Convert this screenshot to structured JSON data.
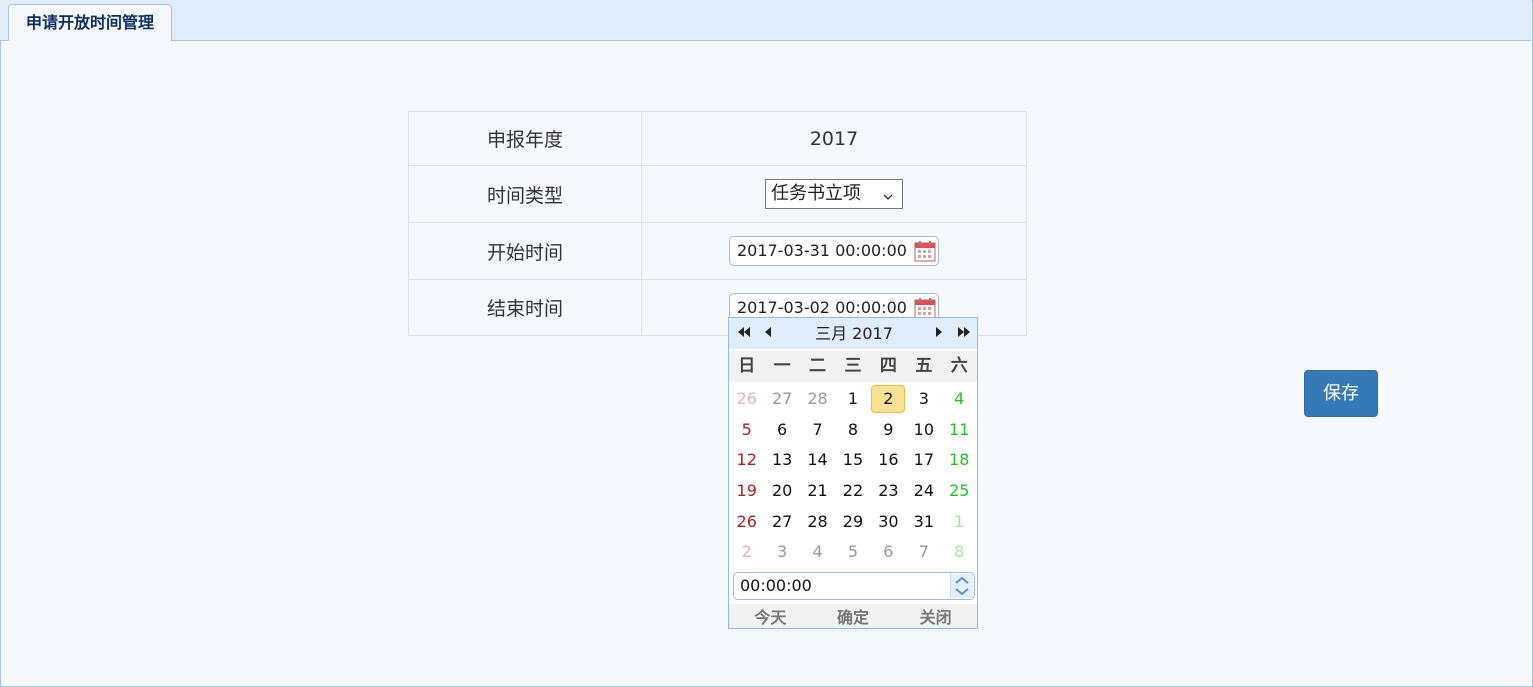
{
  "tab": {
    "label": "申请开放时间管理"
  },
  "form": {
    "rows": [
      {
        "label": "申报年度",
        "value": "2017"
      },
      {
        "label": "时间类型",
        "value": "任务书立项"
      },
      {
        "label": "开始时间",
        "value": "2017-03-31 00:00:00"
      },
      {
        "label": "结束时间",
        "value": "2017-03-02 00:00:00"
      }
    ]
  },
  "save_button": {
    "label": "保存"
  },
  "calendar": {
    "title": "三月 2017",
    "nav": {
      "prev_year": "⏪",
      "prev_month": "◀",
      "next_month": "▶",
      "next_year": "⏩"
    },
    "weekdays": [
      "日",
      "一",
      "二",
      "三",
      "四",
      "五",
      "六"
    ],
    "weeks": [
      [
        "26",
        "27",
        "28",
        "1",
        "2",
        "3",
        "4"
      ],
      [
        "5",
        "6",
        "7",
        "8",
        "9",
        "10",
        "11"
      ],
      [
        "12",
        "13",
        "14",
        "15",
        "16",
        "17",
        "18"
      ],
      [
        "19",
        "20",
        "21",
        "22",
        "23",
        "24",
        "25"
      ],
      [
        "26",
        "27",
        "28",
        "29",
        "30",
        "31",
        "1"
      ],
      [
        "2",
        "3",
        "4",
        "5",
        "6",
        "7",
        "8"
      ]
    ],
    "selected_day": "2",
    "time": "00:00:00",
    "buttons": {
      "today": "今天",
      "ok": "确定",
      "close": "关闭"
    }
  },
  "colors": {
    "accent": "#337ab7",
    "header_bg": "#e0ecff",
    "selected_bg": "#fbe193",
    "sunday": "#b02020",
    "saturday": "#1fc41f"
  },
  "icons": {
    "date_picker": "calendar-icon",
    "select": "chevron-down-icon"
  }
}
